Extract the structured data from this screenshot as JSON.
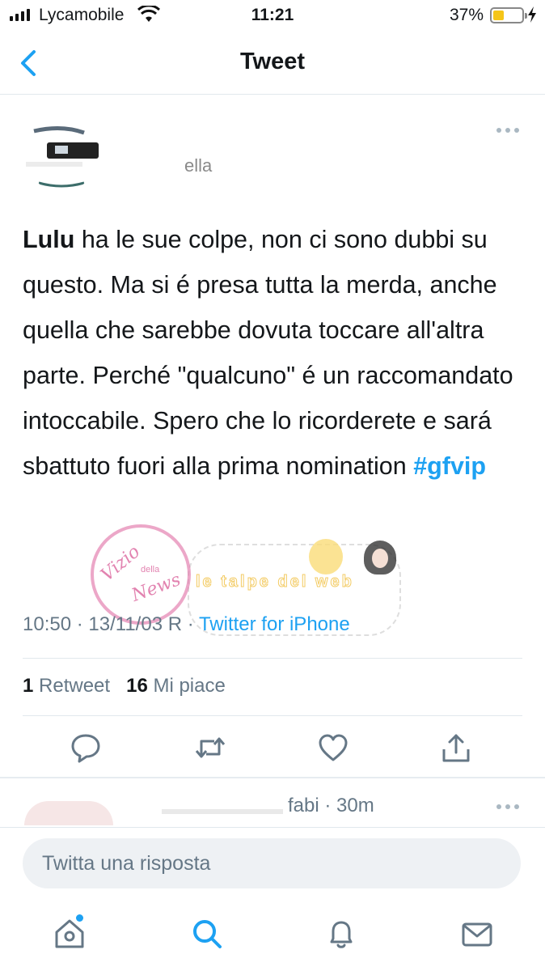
{
  "status_bar": {
    "carrier": "Lycamobile",
    "time": "11:21",
    "battery_percent_label": "37%",
    "battery_level": 0.37,
    "battery_color": "#f5c518"
  },
  "nav": {
    "back_icon": "chevron-left-icon",
    "title": "Tweet",
    "accent_color": "#1da1f2"
  },
  "tweet": {
    "author_handle_fragment": "ella",
    "mention": "Lulu",
    "text": " ha le sue colpe, non ci sono dubbi su questo. Ma si é presa tutta la merda, anche quella che sarebbe dovuta toccare all'altra parte. Perché \"qualcuno\" é un raccomandato intoccabile. Spero che lo ricorderete e sará sbattuto fuori alla prima nomination ",
    "hashtag": "#gfvip",
    "time": "10:50",
    "date": "13/11/03 R",
    "separator": "·",
    "source": "Twitter for iPhone",
    "retweets_count": "1",
    "retweets_label": "Retweet",
    "likes_count": "16",
    "likes_label": "Mi piace",
    "more_icon": "more-horizontal-icon"
  },
  "actions": {
    "reply_icon": "comment-icon",
    "retweet_icon": "retweet-icon",
    "like_icon": "heart-icon",
    "share_icon": "share-icon"
  },
  "reply_preview": {
    "time_fragment": "fabi · 30m"
  },
  "reply_input": {
    "placeholder": "Twitta una risposta"
  },
  "tab_bar": {
    "items": [
      "home-icon",
      "search-icon",
      "notifications-bell-icon",
      "messages-envelope-icon"
    ],
    "active": "search-icon"
  },
  "watermark": {
    "seal_line1": "Vizio",
    "seal_line2": "della",
    "seal_line3": "News",
    "banner": "le talpe del web"
  }
}
